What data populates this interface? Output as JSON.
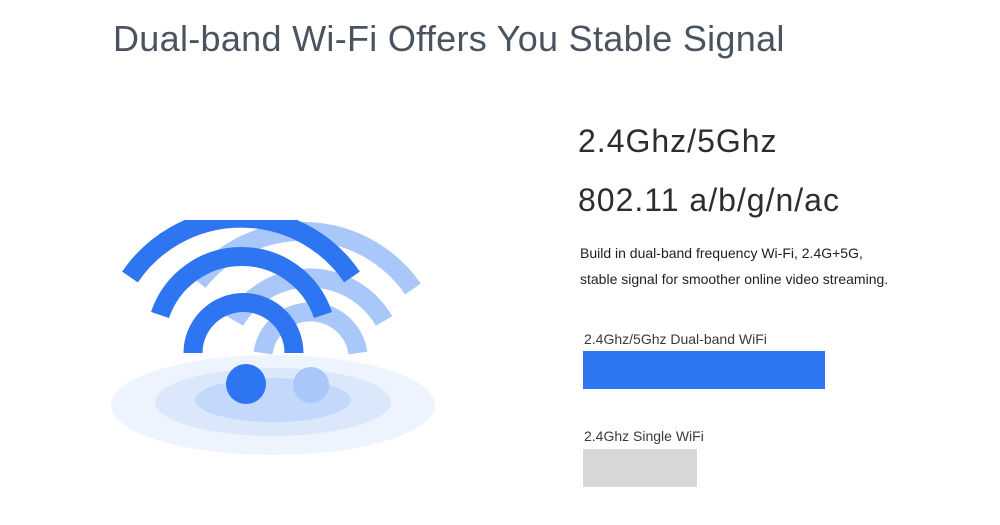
{
  "header": {
    "title": "Dual-band Wi-Fi Offers You Stable Signal"
  },
  "specs": {
    "band": "2.4Ghz/5Ghz",
    "standard": "802.11 a/b/g/n/ac",
    "description_lines": [
      "Build in dual-band frequency Wi-Fi, 2.4G+5G,",
      "stable signal for smoother online video streaming."
    ]
  },
  "comparison": [
    {
      "label": "2.4Ghz/5Ghz Dual-band WiFi",
      "level": 1.0,
      "color": "#2e75f2"
    },
    {
      "label": "2.4Ghz Single WiFi",
      "level": 0.47,
      "color": "#d7d7d7"
    }
  ],
  "illustration": {
    "icon": "wifi-signal-icon",
    "primary_color": "#2e75f2",
    "secondary_color": "#a9c7f9",
    "ripple_color": "#dbe8fc"
  }
}
